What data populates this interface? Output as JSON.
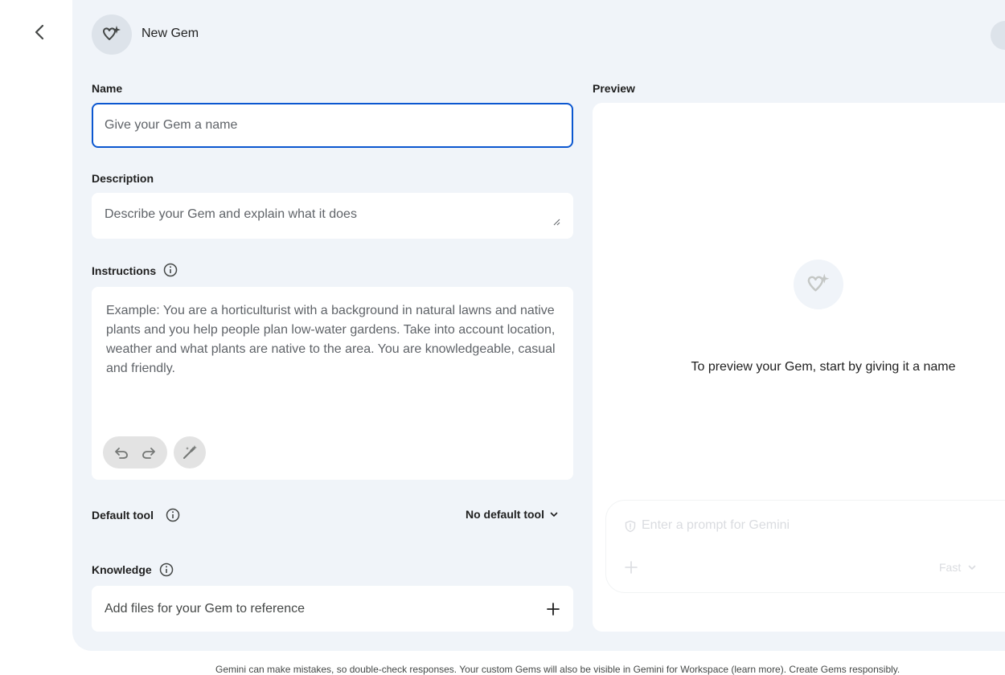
{
  "header": {
    "title": "New Gem"
  },
  "form": {
    "name_label": "Name",
    "name_placeholder": "Give your Gem a name",
    "description_label": "Description",
    "description_placeholder": "Describe your Gem and explain what it does",
    "instructions_label": "Instructions",
    "instructions_placeholder": "Example: You are a horticulturist with a background in natural lawns and native plants and you help people plan low-water gardens. Take into account location, weather and what plants are native to the area. You are knowledgeable, casual and friendly.",
    "default_tool_label": "Default tool",
    "default_tool_value": "No default tool",
    "knowledge_label": "Knowledge",
    "knowledge_placeholder": "Add files for your Gem to reference"
  },
  "preview": {
    "label": "Preview",
    "message": "To preview your Gem, start by giving it a name",
    "prompt_placeholder": "Enter a prompt for Gemini",
    "mode": "Fast"
  },
  "footer": {
    "note": "Gemini can make mistakes, so double-check responses. Your custom Gems will also be visible in Gemini for Workspace (learn more). Create Gems responsibly."
  },
  "icons": {
    "back": "chevron-left-icon",
    "gem": "gem-sparkle-icon",
    "info": "info-icon",
    "undo": "undo-icon",
    "redo": "redo-icon",
    "magic": "magic-wand-icon",
    "chevron": "chevron-down-icon",
    "plus": "plus-icon",
    "shield": "shield-icon"
  },
  "colors": {
    "accent": "#0b57d0",
    "panel_bg": "#f0f4f9"
  }
}
